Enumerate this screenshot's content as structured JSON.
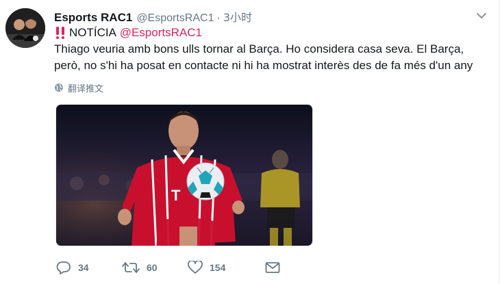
{
  "tweet": {
    "display_name": "Esports RAC1",
    "handle": "@EsportsRAC1",
    "separator": "·",
    "time": "3小时",
    "line1_label": "NOTÍCIA",
    "line1_mention": "@EsportsRAC1",
    "body_line1": "Thiago veuria amb bons ulls tornar al Barça. Ho considera casa seva. El Barça,",
    "body_line2": "però, no s'hi ha posat en contacte ni hi ha mostrat interès des de fa més d'un any",
    "translate_label": "翻译推文",
    "jersey_text": "T"
  },
  "actions": {
    "reply_count": "34",
    "retweet_count": "60",
    "like_count": "154"
  },
  "colors": {
    "text": "#14171a",
    "secondary": "#657786",
    "mention": "#e0245e",
    "exclaim": "#e0245e",
    "jersey_red": "#c8102e"
  },
  "icons": [
    "caret-down-icon",
    "double-exclamation-icon",
    "globe-icon",
    "reply-icon",
    "retweet-icon",
    "heart-icon",
    "envelope-icon"
  ]
}
